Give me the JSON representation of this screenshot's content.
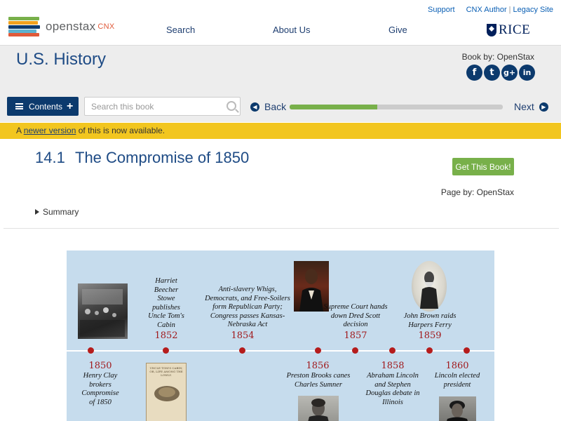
{
  "header": {
    "logo_word": "openstax",
    "logo_cnx": "CNX",
    "utility_links": {
      "support": "Support",
      "author": "CNX Author",
      "legacy": "Legacy Site",
      "sep": "|"
    },
    "nav": {
      "search": "Search",
      "about": "About Us",
      "give": "Give"
    },
    "rice": "RICE"
  },
  "book": {
    "title": "U.S. History",
    "book_by": "Book by: OpenStax",
    "social": [
      "f",
      "t",
      "g+",
      "in"
    ],
    "contents_label": "Contents",
    "search_placeholder": "Search this book",
    "back_label": "Back",
    "next_label": "Next",
    "progress": 0.41
  },
  "notice": {
    "prefix": "A ",
    "link": "newer version",
    "suffix": " of this is now available."
  },
  "page": {
    "section_number": "14.1",
    "section_title": "The Compromise of 1850",
    "get_book": "Get This Book!",
    "page_by": "Page by: OpenStax",
    "summary": "Summary"
  },
  "timeline": {
    "above": [
      {
        "year": "1852",
        "event": "Harriet Beecher Stowe publishes Uncle Tom's Cabin"
      },
      {
        "year": "1854",
        "event": "Anti-slavery Whigs, Democrats, and Free-Soilers form Republican Party; Congress passes Kansas-Nebraska Act"
      },
      {
        "year": "1857",
        "event": "Supreme Court hands down Dred Scott decision"
      },
      {
        "year": "1859",
        "event": "John Brown raids Harpers Ferry"
      }
    ],
    "below": [
      {
        "year": "1850",
        "event": "Henry Clay brokers Compromise of 1850"
      },
      {
        "year": "1856",
        "event": "Preston Brooks canes Charles Sumner"
      },
      {
        "year": "1858",
        "event": "Abraham Lincoln and Stephen Douglas debate in Illinois"
      },
      {
        "year": "1860",
        "event": "Lincoln elected president"
      }
    ],
    "book_cover_text": "UNCLE TOM'S CABIN; OR, LIFE AMONG THE LOWLY."
  },
  "colors": {
    "brand_navy": "#0c3a6d",
    "title_blue": "#1e4b85",
    "progress_green": "#78b04a",
    "notice_yellow": "#f2c61f",
    "timeline_bg": "#c6dced",
    "timeline_dot": "#b51c1c"
  }
}
